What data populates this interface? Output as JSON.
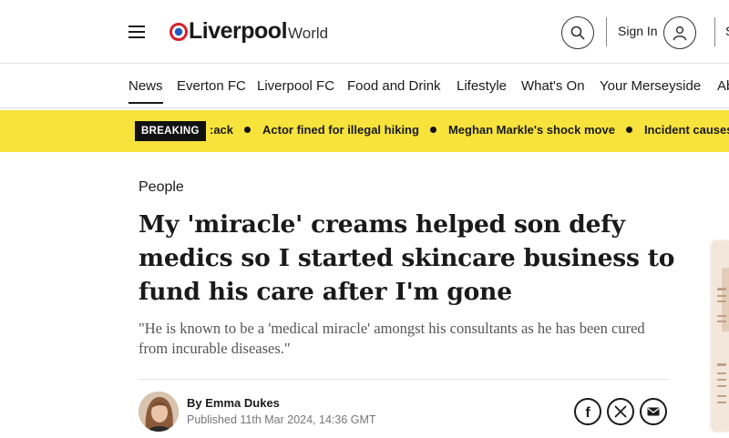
{
  "header": {
    "logo_main": "Liverpool",
    "logo_sub": "World",
    "signin_label": "Sign In",
    "edge_letter": "S",
    "icons": {
      "menu": "hamburger-icon",
      "search": "search-icon",
      "user": "user-icon"
    },
    "colors": {
      "logo_red": "#d6202a",
      "logo_blue": "#1d5bbf"
    }
  },
  "nav": {
    "items": [
      "News",
      "Everton FC",
      "Liverpool FC",
      "Food and Drink",
      "Lifestyle",
      "What's On",
      "Your Merseyside",
      "Ab"
    ],
    "active": "News"
  },
  "breaking": {
    "label": "BREAKING",
    "items": [
      ":ack",
      "Actor fined for illegal hiking",
      "Meghan Markle's shock move",
      "Incident causes d"
    ],
    "color": "#f7e33c"
  },
  "article": {
    "category": "People",
    "headline": "My 'miracle' creams helped son defy medics so I started skincare business to fund his care after I'm gone",
    "standfirst": "\"He is known to be a 'medical miracle' amongst his consultants as he has been cured from incurable diseases.\"",
    "byline_prefix": "By",
    "author": "Emma Dukes",
    "published": "Published 11th Mar 2024, 14:36 GMT"
  },
  "share": {
    "icons": [
      "facebook-icon",
      "x-icon",
      "email-icon"
    ],
    "facebook_glyph": "f"
  }
}
